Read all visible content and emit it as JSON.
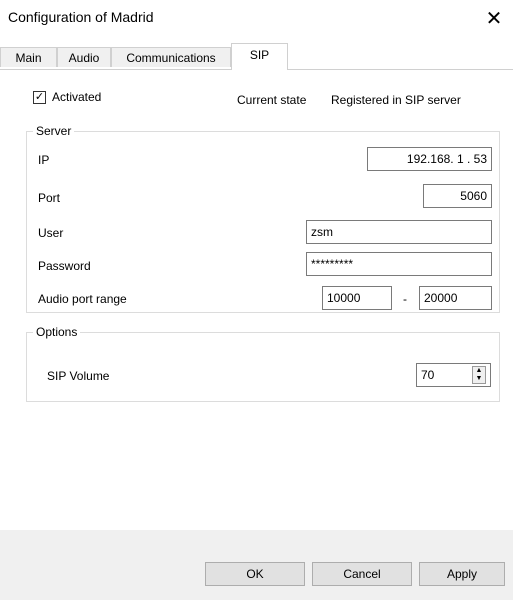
{
  "window": {
    "title": "Configuration of Madrid",
    "close_glyph": "✕"
  },
  "tabs": [
    {
      "label": "Main",
      "active": false
    },
    {
      "label": "Audio",
      "active": false
    },
    {
      "label": "Communications",
      "active": false
    },
    {
      "label": "SIP",
      "active": true
    }
  ],
  "sip": {
    "activated_label": "Activated",
    "activated_checked": true,
    "check_glyph": "✓",
    "current_state_label": "Current state",
    "current_state_value": "Registered in SIP server"
  },
  "server": {
    "legend": "Server",
    "ip_label": "IP",
    "ip_value": "192.168. 1 . 53",
    "port_label": "Port",
    "port_value": "5060",
    "user_label": "User",
    "user_value": "zsm",
    "password_label": "Password",
    "password_value": "*********",
    "audio_range_label": "Audio port range",
    "audio_range_from": "10000",
    "audio_range_sep": "-",
    "audio_range_to": "20000"
  },
  "options": {
    "legend": "Options",
    "sip_volume_label": "SIP Volume",
    "sip_volume_value": "70"
  },
  "buttons": {
    "ok": "OK",
    "cancel": "Cancel",
    "apply": "Apply"
  }
}
